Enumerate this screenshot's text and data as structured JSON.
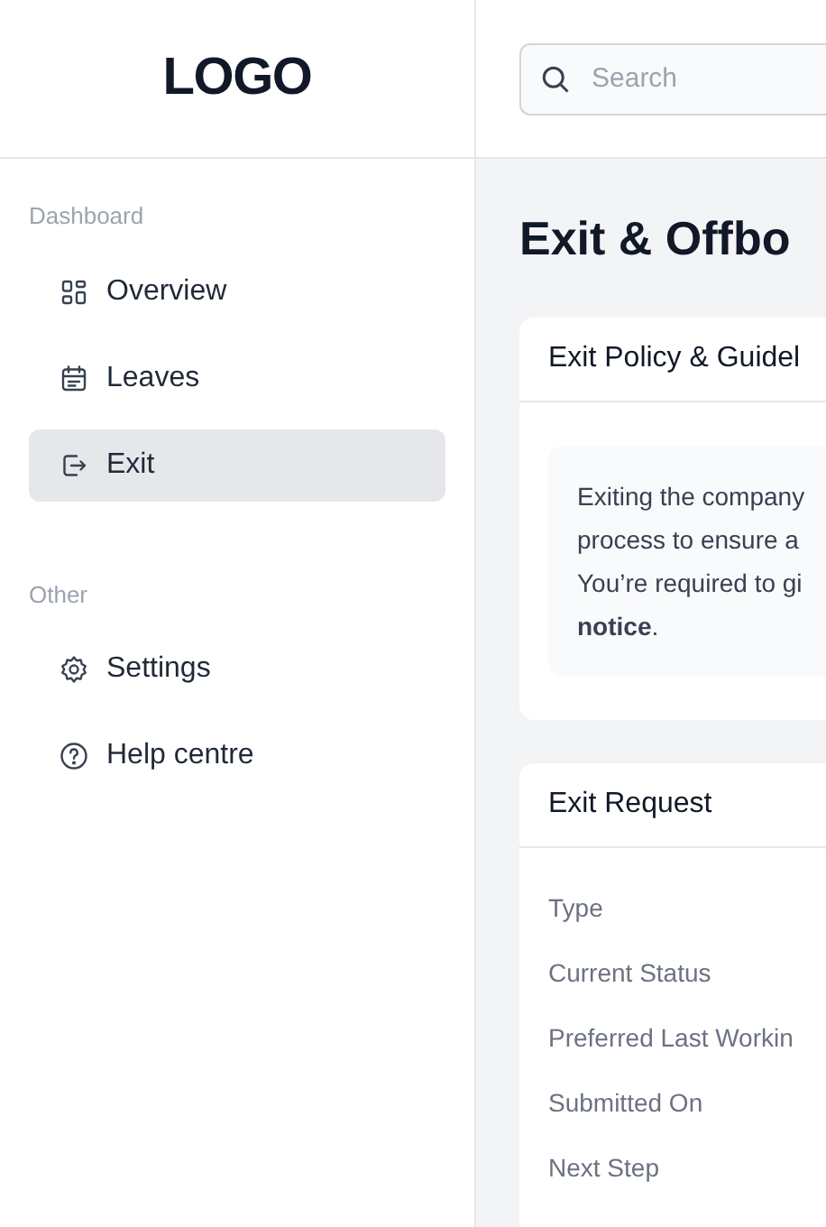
{
  "logo": "LOGO",
  "search": {
    "placeholder": "Search"
  },
  "sidebar": {
    "sections": [
      {
        "heading": "Dashboard",
        "items": [
          {
            "label": "Overview",
            "kind": "grid",
            "selected": false
          },
          {
            "label": "Leaves",
            "kind": "calendar",
            "selected": false
          },
          {
            "label": "Exit",
            "kind": "exit",
            "selected": true
          }
        ]
      },
      {
        "heading": "Other",
        "items": [
          {
            "label": "Settings",
            "kind": "gear",
            "selected": false
          },
          {
            "label": "Help centre",
            "kind": "help",
            "selected": false
          }
        ]
      }
    ]
  },
  "page_title": "Exit & Offbo",
  "policy_card": {
    "title": "Exit Policy & Guidel",
    "lines": [
      "Exiting the company",
      "process to ensure a",
      "You’re required to gi",
      "**notice**."
    ]
  },
  "request_card": {
    "title": "Exit Request",
    "fields": [
      "Type",
      "Current Status",
      "Preferred Last Workin",
      "Submitted On",
      "Next Step"
    ]
  }
}
